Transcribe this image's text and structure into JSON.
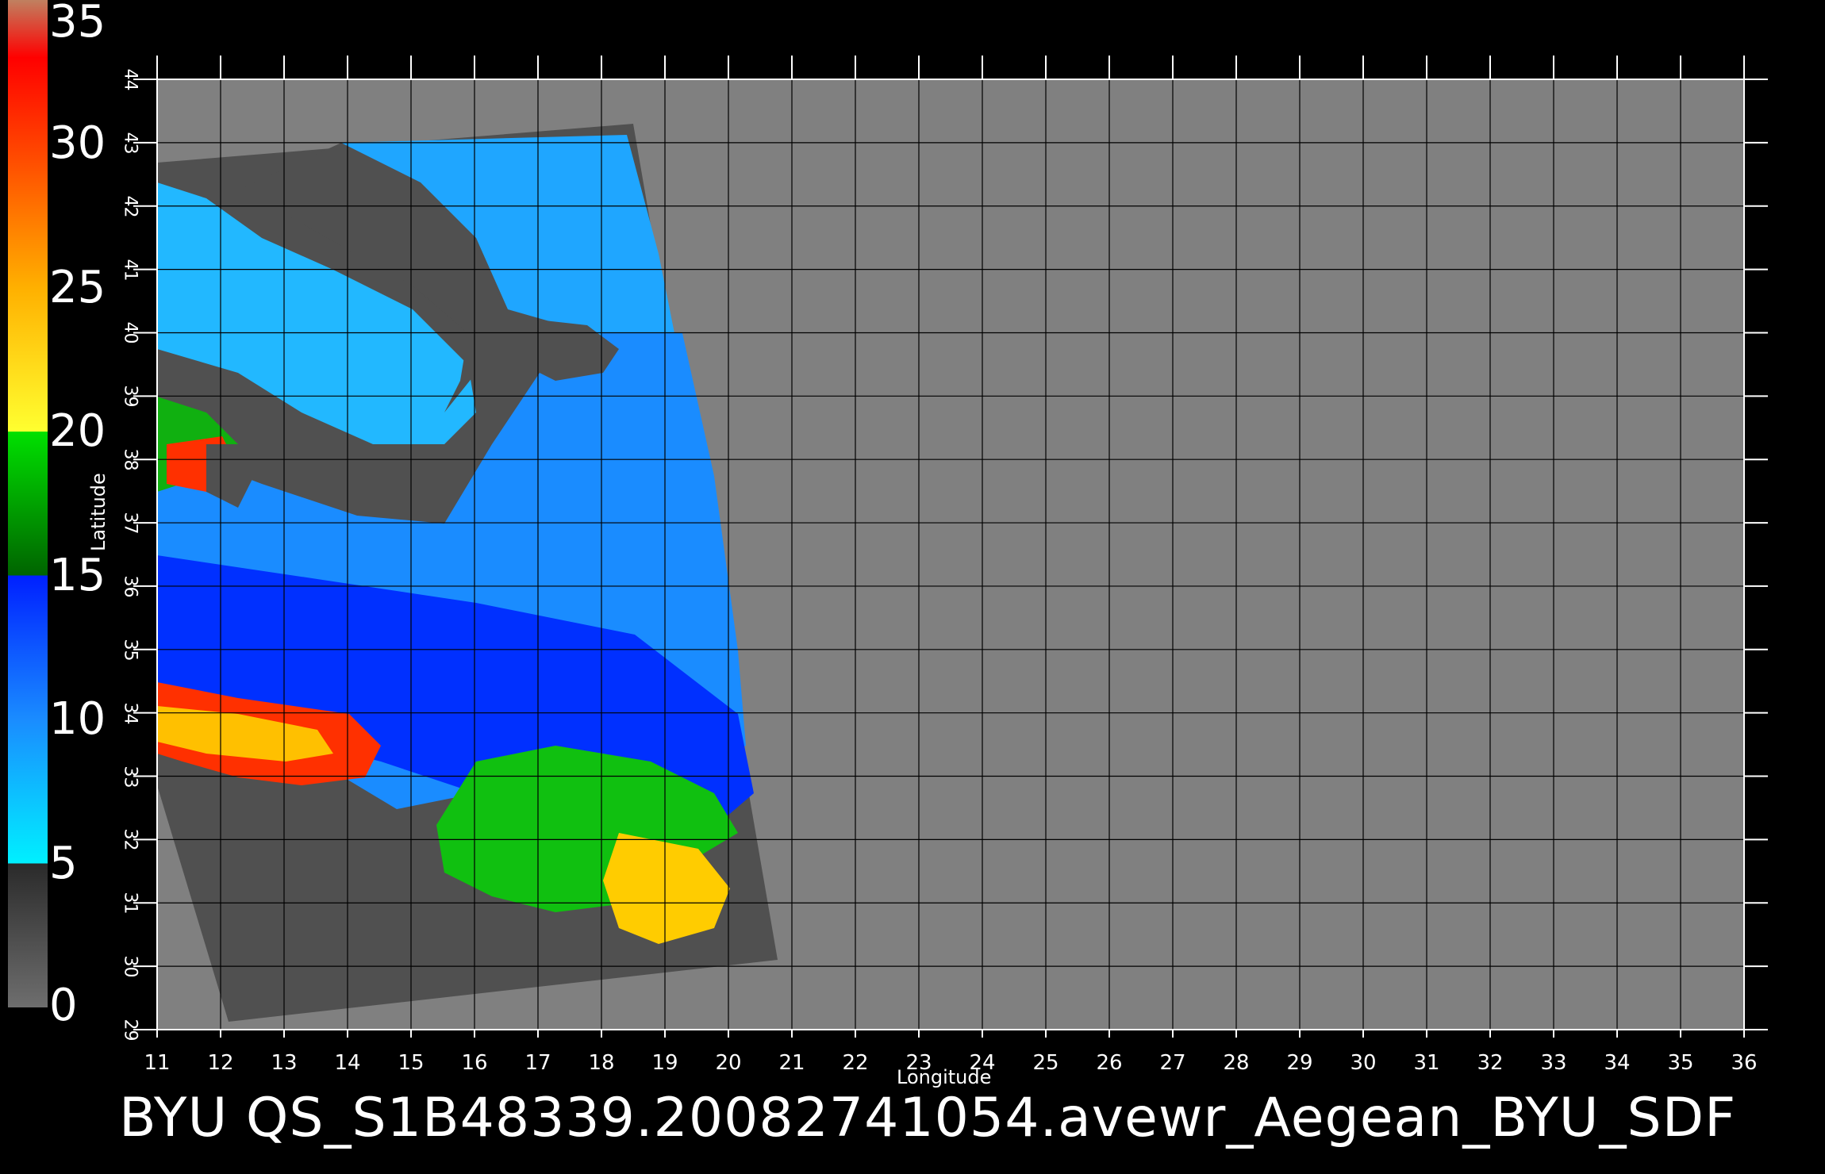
{
  "caption": "BYU  QS_S1B48339.20082741054.avewr_Aegean_BYU_SDF",
  "axes": {
    "xlabel": "Longitude",
    "ylabel": "Latitude",
    "lon_ticks": [
      "11",
      "12",
      "13",
      "14",
      "15",
      "16",
      "17",
      "18",
      "19",
      "20",
      "21",
      "22",
      "23",
      "24",
      "25",
      "26",
      "27",
      "28",
      "29",
      "30",
      "31",
      "32",
      "33",
      "34",
      "35",
      "36"
    ],
    "lat_ticks": [
      "29",
      "30",
      "31",
      "32",
      "33",
      "34",
      "35",
      "36",
      "37",
      "38",
      "39",
      "40",
      "41",
      "42",
      "43",
      "44"
    ],
    "lon_range": [
      11,
      36
    ],
    "lat_range": [
      29,
      44
    ],
    "grid": true
  },
  "colorbar": {
    "labels": [
      "35",
      "30",
      "25",
      "20",
      "15",
      "10",
      "5",
      "0"
    ],
    "range": [
      0,
      35
    ],
    "stops": [
      {
        "value": 0,
        "color": "#6e6e6e"
      },
      {
        "value": 5,
        "color": "#2a2a2a"
      },
      {
        "value": 5.01,
        "color": "#00f0ff"
      },
      {
        "value": 10,
        "color": "#1a8cff"
      },
      {
        "value": 15,
        "color": "#0020ff"
      },
      {
        "value": 15.01,
        "color": "#006400"
      },
      {
        "value": 20,
        "color": "#00e000"
      },
      {
        "value": 20.01,
        "color": "#ffff30"
      },
      {
        "value": 25,
        "color": "#ffb000"
      },
      {
        "value": 30,
        "color": "#ff4000"
      },
      {
        "value": 33,
        "color": "#ff0000"
      },
      {
        "value": 35,
        "color": "#c08060"
      }
    ]
  },
  "colors": {
    "background": "#000000",
    "no_data": "#808080",
    "swath_no_data": "#505050",
    "land": "#505050",
    "grid": "#000000"
  }
}
